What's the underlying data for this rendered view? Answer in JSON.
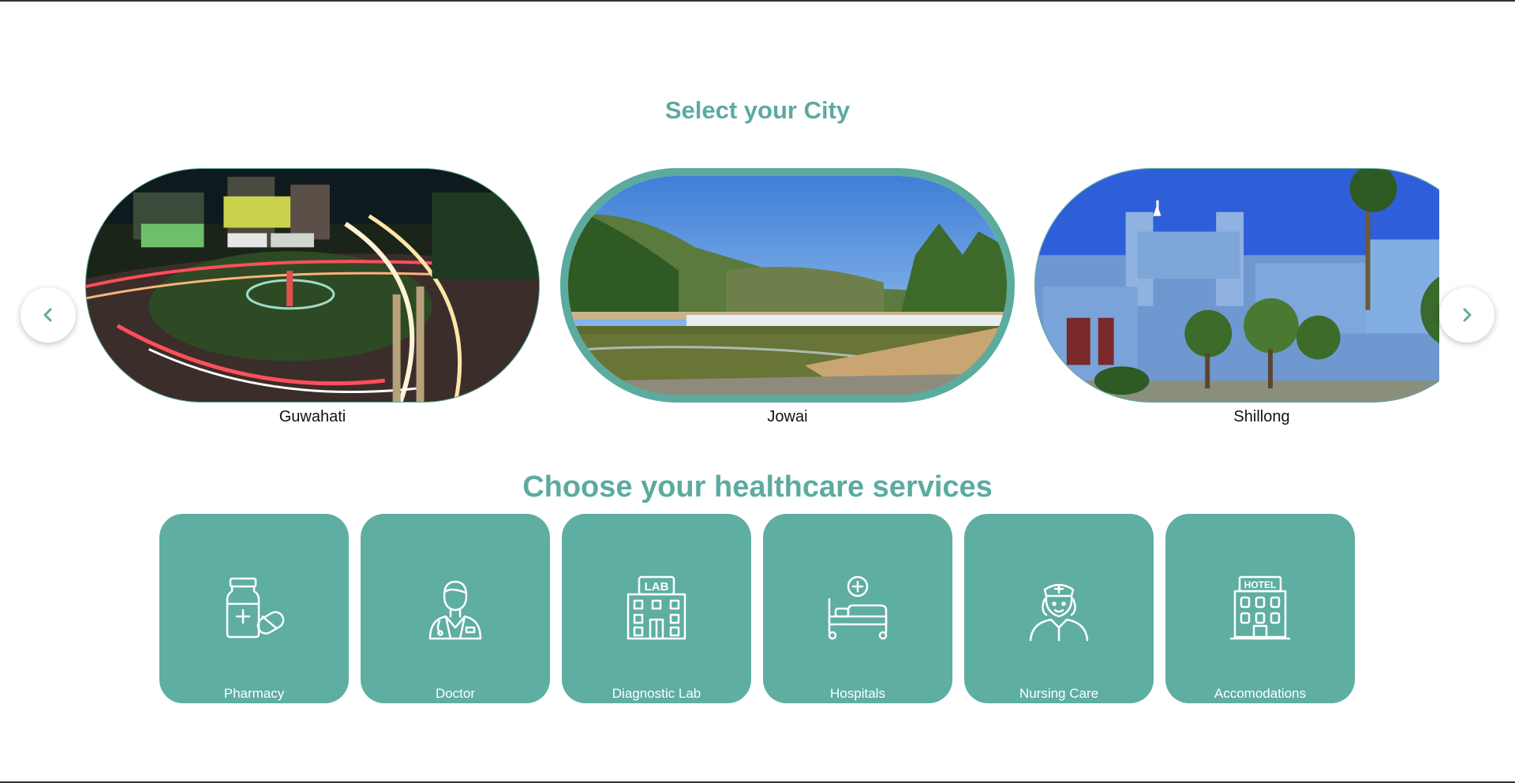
{
  "city_section": {
    "title": "Select your City",
    "cities": [
      {
        "name": "Guwahati"
      },
      {
        "name": "Jowai"
      },
      {
        "name": "Shillong"
      }
    ],
    "prev_icon": "chevron-left-icon",
    "next_icon": "chevron-right-icon"
  },
  "services_section": {
    "title": "Choose your healthcare services",
    "services": [
      {
        "label": "Pharmacy",
        "icon": "pharmacy-icon"
      },
      {
        "label": "Doctor",
        "icon": "doctor-icon"
      },
      {
        "label": "Diagnostic Lab",
        "icon": "lab-icon",
        "icon_text": "LAB"
      },
      {
        "label": "Hospitals",
        "icon": "hospital-bed-icon"
      },
      {
        "label": "Nursing Care",
        "icon": "nurse-icon"
      },
      {
        "label": "Accomodations",
        "icon": "hotel-icon",
        "icon_text": "HOTEL"
      }
    ]
  },
  "colors": {
    "accent": "#5bab9f",
    "card": "#5eaea2",
    "text": "#111111"
  }
}
